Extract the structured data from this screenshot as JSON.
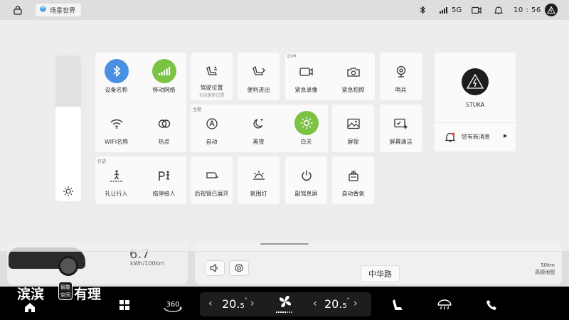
{
  "status_bar": {
    "scene_label": "场景世界",
    "network_label": "5G",
    "time": "10 : 56"
  },
  "panel": {
    "brightness_level": 0.65,
    "connectivity": [
      {
        "key": "bluetooth",
        "label": "设备名称",
        "icon": "bluetooth-icon",
        "active": true,
        "color": "#4a90e2"
      },
      {
        "key": "mobile-network",
        "label": "移动网络",
        "icon": "signal-icon",
        "active": true,
        "color": "#7cc243"
      },
      {
        "key": "wifi",
        "label": "WIFI名称",
        "icon": "wifi-icon",
        "active": false
      },
      {
        "key": "hotspot",
        "label": "热点",
        "icon": "hotspot-icon",
        "active": false
      }
    ],
    "seat": {
      "label": "驾驶位置",
      "sub": "长按更新位置",
      "icon": "driver-seat-icon"
    },
    "easy_access": {
      "label": "便利进出",
      "icon": "easy-entry-seat-icon"
    },
    "dvr": {
      "tag": "DVR",
      "items": [
        {
          "label": "紧急录像",
          "icon": "video-record-icon"
        },
        {
          "label": "紧急拍照",
          "icon": "camera-icon"
        }
      ]
    },
    "sentry": {
      "label": "哨兵",
      "icon": "sentry-camera-icon"
    },
    "theme": {
      "tag": "主题",
      "items": [
        {
          "label": "自动",
          "icon": "auto-mode-icon",
          "active": false
        },
        {
          "label": "黑夜",
          "icon": "moon-icon",
          "active": false
        },
        {
          "label": "白天",
          "icon": "sun-icon",
          "active": true,
          "color": "#7cc243"
        }
      ]
    },
    "screensaver": {
      "label": "屏保",
      "icon": "image-icon"
    },
    "screen_clean": {
      "label": "屏幕清洁",
      "icon": "screen-clean-icon"
    },
    "lights": {
      "tag": "灯语",
      "items": [
        {
          "label": "礼让行人",
          "icon": "pedestrian-icon"
        },
        {
          "label": "临停接人",
          "icon": "pickup-icon"
        }
      ]
    },
    "row3": [
      {
        "label": "后视镜已展开",
        "icon": "mirror-icon"
      },
      {
        "label": "氛围灯",
        "icon": "ambient-light-icon"
      },
      {
        "label": "副驾息屏",
        "icon": "power-icon"
      },
      {
        "label": "自动香氛",
        "icon": "fragrance-icon"
      }
    ],
    "profile": {
      "name": "STUKA",
      "message": "您有新消息"
    }
  },
  "background": {
    "energy_value": "6.7",
    "energy_unit": "kWh/100km",
    "road_name": "中华路",
    "scale_label": "50km",
    "map_source": "高德地图"
  },
  "dock": {
    "logo_left": "滨滨",
    "logo_badge": "智能空间",
    "logo_right": "有理",
    "view_360_label": "360",
    "left_temp": {
      "int": "20.",
      "dec": "5",
      "unit": "°"
    },
    "right_temp": {
      "int": "20.",
      "dec": "5",
      "unit": "°"
    },
    "fan_level": 5,
    "fan_level_max": 8
  }
}
